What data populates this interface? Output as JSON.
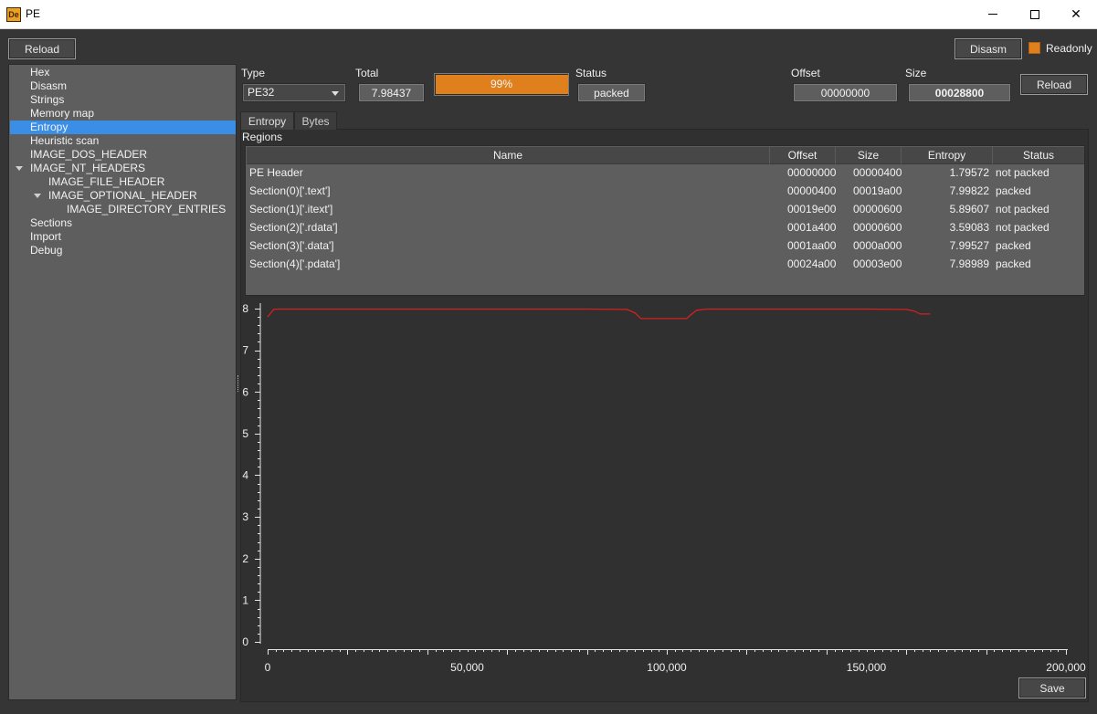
{
  "window": {
    "title": "PE",
    "icon_text": "De"
  },
  "toolbar": {
    "reload_label": "Reload",
    "disasm_label": "Disasm",
    "readonly_label": "Readonly",
    "readonly_checked": true
  },
  "sidebar": {
    "items": [
      {
        "label": "Hex"
      },
      {
        "label": "Disasm"
      },
      {
        "label": "Strings"
      },
      {
        "label": "Memory map"
      },
      {
        "label": "Entropy",
        "selected": true
      },
      {
        "label": "Heuristic scan"
      },
      {
        "label": "IMAGE_DOS_HEADER"
      },
      {
        "label": "IMAGE_NT_HEADERS",
        "expanded": true
      },
      {
        "label": "IMAGE_FILE_HEADER"
      },
      {
        "label": "IMAGE_OPTIONAL_HEADER",
        "expanded": true
      },
      {
        "label": "IMAGE_DIRECTORY_ENTRIES"
      },
      {
        "label": "Sections"
      },
      {
        "label": "Import"
      },
      {
        "label": "Debug"
      }
    ]
  },
  "info": {
    "type_label": "Type",
    "type_value": "PE32",
    "total_label": "Total",
    "total_value": "7.98437",
    "progress_text": "99%",
    "progress_fraction": 0.99,
    "status_label": "Status",
    "status_value": "packed",
    "offset_label": "Offset",
    "offset_value": "00000000",
    "size_label": "Size",
    "size_value": "00028800",
    "reload_label": "Reload"
  },
  "tabs": [
    {
      "label": "Entropy",
      "active": true
    },
    {
      "label": "Bytes"
    }
  ],
  "regions": {
    "label": "Regions",
    "columns": [
      "Name",
      "Offset",
      "Size",
      "Entropy",
      "Status"
    ],
    "rows": [
      {
        "name": "PE Header",
        "offset": "00000000",
        "size": "00000400",
        "entropy": "1.79572",
        "status": "not packed"
      },
      {
        "name": "Section(0)['.text']",
        "offset": "00000400",
        "size": "00019a00",
        "entropy": "7.99822",
        "status": "packed"
      },
      {
        "name": "Section(1)['.itext']",
        "offset": "00019e00",
        "size": "00000600",
        "entropy": "5.89607",
        "status": "not packed"
      },
      {
        "name": "Section(2)['.rdata']",
        "offset": "0001a400",
        "size": "00000600",
        "entropy": "3.59083",
        "status": "not packed"
      },
      {
        "name": "Section(3)['.data']",
        "offset": "0001aa00",
        "size": "0000a000",
        "entropy": "7.99527",
        "status": "packed"
      },
      {
        "name": "Section(4)['.pdata']",
        "offset": "00024a00",
        "size": "00003e00",
        "entropy": "7.98989",
        "status": "packed"
      }
    ]
  },
  "chart_data": {
    "type": "line",
    "xlim": [
      0,
      200000
    ],
    "ylim": [
      0,
      8
    ],
    "x_ticks": [
      0,
      50000,
      100000,
      150000,
      200000
    ],
    "x_tick_labels": [
      "0",
      "50,000",
      "100,000",
      "150,000",
      "200,000"
    ],
    "y_ticks": [
      0,
      1,
      2,
      3,
      4,
      5,
      6,
      7,
      8
    ],
    "y_tick_labels": [
      "0",
      "1",
      "2",
      "3",
      "4",
      "5",
      "6",
      "7",
      "8"
    ],
    "series": [
      {
        "color": "#d42020",
        "x": [
          0,
          1500,
          3000,
          20000,
          40000,
          60000,
          80000,
          90000,
          92000,
          93500,
          100000,
          105000,
          106000,
          107500,
          110000,
          130000,
          150000,
          160000,
          162000,
          163500,
          166000
        ],
        "y": [
          7.8,
          7.98,
          7.99,
          7.99,
          7.99,
          7.99,
          7.99,
          7.98,
          7.9,
          7.76,
          7.76,
          7.76,
          7.85,
          7.96,
          7.99,
          7.99,
          7.99,
          7.98,
          7.94,
          7.87,
          7.87
        ]
      }
    ]
  },
  "footer": {
    "save_label": "Save"
  }
}
